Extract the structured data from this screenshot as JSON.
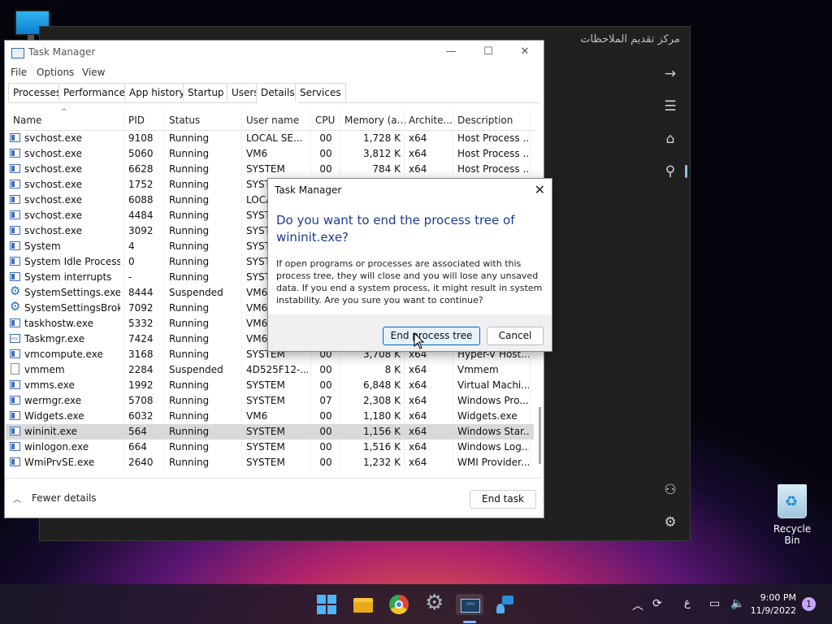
{
  "desktop": {
    "recycle_bin_label": "Recycle Bin"
  },
  "notes_app": {
    "title": "مركز تقديم الملاحظات"
  },
  "task_manager": {
    "title": "Task Manager",
    "menu": [
      "File",
      "Options",
      "View"
    ],
    "tabs": [
      "Processes",
      "Performance",
      "App history",
      "Startup",
      "Users",
      "Details",
      "Services"
    ],
    "active_tab": "Details",
    "columns": [
      "Name",
      "PID",
      "Status",
      "User name",
      "CPU",
      "Memory (a...",
      "Archite...",
      "Description"
    ],
    "rows": [
      {
        "icon": "service-icon",
        "name": "svchost.exe",
        "pid": "9108",
        "status": "Running",
        "user": "LOCAL SE...",
        "cpu": "00",
        "mem": "1,728 K",
        "arch": "x64",
        "desc": "Host Process ..."
      },
      {
        "icon": "service-icon",
        "name": "svchost.exe",
        "pid": "5060",
        "status": "Running",
        "user": "VM6",
        "cpu": "00",
        "mem": "3,812 K",
        "arch": "x64",
        "desc": "Host Process ..."
      },
      {
        "icon": "service-icon",
        "name": "svchost.exe",
        "pid": "6628",
        "status": "Running",
        "user": "SYSTEM",
        "cpu": "00",
        "mem": "784 K",
        "arch": "x64",
        "desc": "Host Process ..."
      },
      {
        "icon": "service-icon",
        "name": "svchost.exe",
        "pid": "1752",
        "status": "Running",
        "user": "SYST",
        "cpu": "",
        "mem": "",
        "arch": "",
        "desc": ""
      },
      {
        "icon": "service-icon",
        "name": "svchost.exe",
        "pid": "6088",
        "status": "Running",
        "user": "LOCA",
        "cpu": "",
        "mem": "",
        "arch": "",
        "desc": ""
      },
      {
        "icon": "service-icon",
        "name": "svchost.exe",
        "pid": "4484",
        "status": "Running",
        "user": "SYST",
        "cpu": "",
        "mem": "",
        "arch": "",
        "desc": ""
      },
      {
        "icon": "service-icon",
        "name": "svchost.exe",
        "pid": "3092",
        "status": "Running",
        "user": "SYST",
        "cpu": "",
        "mem": "",
        "arch": "",
        "desc": ""
      },
      {
        "icon": "service-icon",
        "name": "System",
        "pid": "4",
        "status": "Running",
        "user": "SYST",
        "cpu": "",
        "mem": "",
        "arch": "",
        "desc": ""
      },
      {
        "icon": "service-icon",
        "name": "System Idle Process",
        "pid": "0",
        "status": "Running",
        "user": "SYST",
        "cpu": "",
        "mem": "",
        "arch": "",
        "desc": ""
      },
      {
        "icon": "service-icon",
        "name": "System interrupts",
        "pid": "-",
        "status": "Running",
        "user": "SYST",
        "cpu": "",
        "mem": "",
        "arch": "",
        "desc": ""
      },
      {
        "icon": "gear-icon",
        "name": "SystemSettings.exe",
        "pid": "8444",
        "status": "Suspended",
        "user": "VM6",
        "cpu": "",
        "mem": "",
        "arch": "",
        "desc": ""
      },
      {
        "icon": "gear-icon",
        "name": "SystemSettingsBroke...",
        "pid": "7092",
        "status": "Running",
        "user": "VM6",
        "cpu": "",
        "mem": "",
        "arch": "",
        "desc": ""
      },
      {
        "icon": "service-icon",
        "name": "taskhostw.exe",
        "pid": "5332",
        "status": "Running",
        "user": "VM6",
        "cpu": "",
        "mem": "",
        "arch": "",
        "desc": ""
      },
      {
        "icon": "taskmgr-icon",
        "name": "Taskmgr.exe",
        "pid": "7424",
        "status": "Running",
        "user": "VM6",
        "cpu": "",
        "mem": "",
        "arch": "",
        "desc": ""
      },
      {
        "icon": "service-icon",
        "name": "vmcompute.exe",
        "pid": "3168",
        "status": "Running",
        "user": "SYSTEM",
        "cpu": "00",
        "mem": "3,708 K",
        "arch": "x64",
        "desc": "Hyper-V Host..."
      },
      {
        "icon": "file-icon",
        "name": "vmmem",
        "pid": "2284",
        "status": "Suspended",
        "user": "4D525F12-...",
        "cpu": "00",
        "mem": "8 K",
        "arch": "x64",
        "desc": "Vmmem"
      },
      {
        "icon": "service-icon",
        "name": "vmms.exe",
        "pid": "1992",
        "status": "Running",
        "user": "SYSTEM",
        "cpu": "00",
        "mem": "6,848 K",
        "arch": "x64",
        "desc": "Virtual Machi..."
      },
      {
        "icon": "report-icon",
        "name": "wermgr.exe",
        "pid": "5708",
        "status": "Running",
        "user": "SYSTEM",
        "cpu": "07",
        "mem": "2,308 K",
        "arch": "x64",
        "desc": "Windows Pro..."
      },
      {
        "icon": "service-icon",
        "name": "Widgets.exe",
        "pid": "6032",
        "status": "Running",
        "user": "VM6",
        "cpu": "00",
        "mem": "1,180 K",
        "arch": "x64",
        "desc": "Widgets.exe"
      },
      {
        "icon": "service-icon",
        "name": "wininit.exe",
        "pid": "564",
        "status": "Running",
        "user": "SYSTEM",
        "cpu": "00",
        "mem": "1,156 K",
        "arch": "x64",
        "desc": "Windows Star..."
      },
      {
        "icon": "service-icon",
        "name": "winlogon.exe",
        "pid": "664",
        "status": "Running",
        "user": "SYSTEM",
        "cpu": "00",
        "mem": "1,516 K",
        "arch": "x64",
        "desc": "Windows Log..."
      },
      {
        "icon": "wmi-icon",
        "name": "WmiPrvSE.exe",
        "pid": "2640",
        "status": "Running",
        "user": "SYSTEM",
        "cpu": "00",
        "mem": "1,232 K",
        "arch": "x64",
        "desc": "WMI Provider..."
      }
    ],
    "selected_row": "wininit.exe",
    "fewer_details_label": "Fewer details",
    "end_task_label": "End task"
  },
  "dialog": {
    "title": "Task Manager",
    "question": "Do you want to end the process tree of wininit.exe?",
    "message": "If open programs or processes are associated with this process tree, they will close and you will lose any unsaved data. If you end a system process, it might result in system instability. Are you sure you want to continue?",
    "confirm_label": "End process tree",
    "cancel_label": "Cancel"
  },
  "taskbar": {
    "time": "9:00 PM",
    "date": "11/9/2022",
    "input_language": "ع",
    "notification_count": "1"
  }
}
